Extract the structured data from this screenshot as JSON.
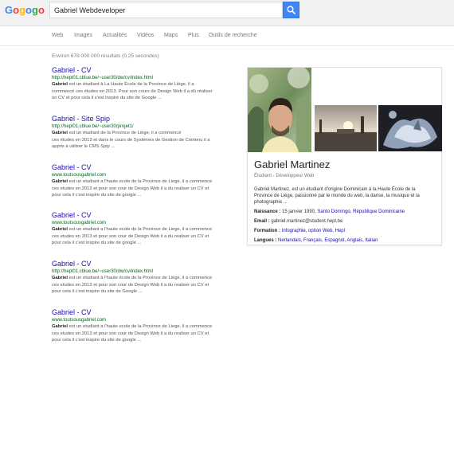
{
  "header": {
    "logo": [
      "G",
      "o",
      "g",
      "o",
      "g",
      "o"
    ],
    "logo_colors": [
      "#4285f4",
      "#ea4335",
      "#fbbc05",
      "#4285f4",
      "#34a853",
      "#ea4335"
    ],
    "search_query": "Gabriel Webdeveloper",
    "search_button_color": "#4285f4"
  },
  "tabs": [
    "Web",
    "Images",
    "Actualités",
    "Vidéos",
    "Maps",
    "Plus",
    "Outils de recherche"
  ],
  "stats": "Environ 678 000 000 résultats (0,25 secondes)",
  "results": [
    {
      "title": "Gabriel - CV",
      "url": "http://hepl01.cblue.be/~user30/dw/cv/index.html",
      "bold": "Gabriel",
      "snippet_lines": [
        " est un étudiant à La Haute École de la Province de Liège, il a",
        "commencé ces études en 2013. Pour son cours de Design Web il a dû réaliser",
        "un CV et pour cela il s'est inspiré du site de Google ..."
      ]
    },
    {
      "title": "Gabriel - Site Spip",
      "url": "http://hepl01.cblue.be/~user30/projet1/",
      "bold": "Gabriel",
      "snippet_lines": [
        " est un étudiant de la Province de Liège, il a commencé",
        "ces études en 2013 et dans le cours de Systèmes de Gestion de Contenu il a",
        "appris à utiliser le CMS Spip ..."
      ]
    },
    {
      "title": "Gabriel - CV",
      "url": "www.toutsousgabriel.com",
      "bold": "Gabriel",
      "snippet_lines": [
        " est un etudiant a l'haute ecole de la Province de Liege, il a commence",
        "ces etudes en 2013 et pour son cour de Design Web il a du realiser un CV et",
        "pour cela il c'est inspire du site de google ..."
      ]
    },
    {
      "title": "Gabriel - CV",
      "url": "www.toutsousgabriel.com",
      "bold": "Gabriel",
      "snippet_lines": [
        " est un etudiant a l'haute ecole de la Province de Liege, il a commence",
        "ces etudes en 2013 et pour son cour de Design Web il a du realiser un CV et",
        "pour cela il c'est inspire du site de google ..."
      ]
    },
    {
      "title": "Gabriel - CV",
      "url": "http://hepl01.cblue.be/~user30/dw/cv/index.html",
      "bold": "Gabriel",
      "snippet_lines": [
        " est un étudiant à l'haute école de la Province de Liège, il a commence",
        "ces etudes en 2013 et pour son cour de Design Web il a du realiser un CV et",
        "pour cela il c'est inspire du site de Google ..."
      ]
    },
    {
      "title": "Gabriel - CV",
      "url": "www.toutsousgabriel.com",
      "bold": "Gabriel",
      "snippet_lines": [
        " est un etudiant a l'haute ecole de la Province de Liege, il a commence",
        "ces etudes en 2013 et pour son cour de Design Web il a du realiser un CV et",
        "pour cela il c'est inspire du site de google ..."
      ]
    }
  ],
  "knowledge_panel": {
    "name": "Gabriel Martinez",
    "subtitle": "Étudiant - Développeur Web",
    "description_lines": [
      "Gabriel Martinez, est un étudiant d'origine Dominicain à la Haute École de la",
      "Province de Liège, passionné par le monde du web, la danse, la musique et la",
      "photographie ..."
    ],
    "birth": {
      "label": "Naissance :",
      "date": "15 janvier 1990,",
      "place1": "Santo Domingo,",
      "place2": "République Dominicaine"
    },
    "email": {
      "label": "Email :",
      "value": "gabriel.martinez@student.hepl.be"
    },
    "formation": {
      "label": "Formation :",
      "items": [
        "Infographie,",
        "option Web,",
        "Hepl"
      ]
    },
    "languages": {
      "label": "Langues :",
      "items": [
        "Nerlandais,",
        "Français,",
        "Espagnol,",
        "Anglais,",
        "Italian"
      ]
    }
  }
}
